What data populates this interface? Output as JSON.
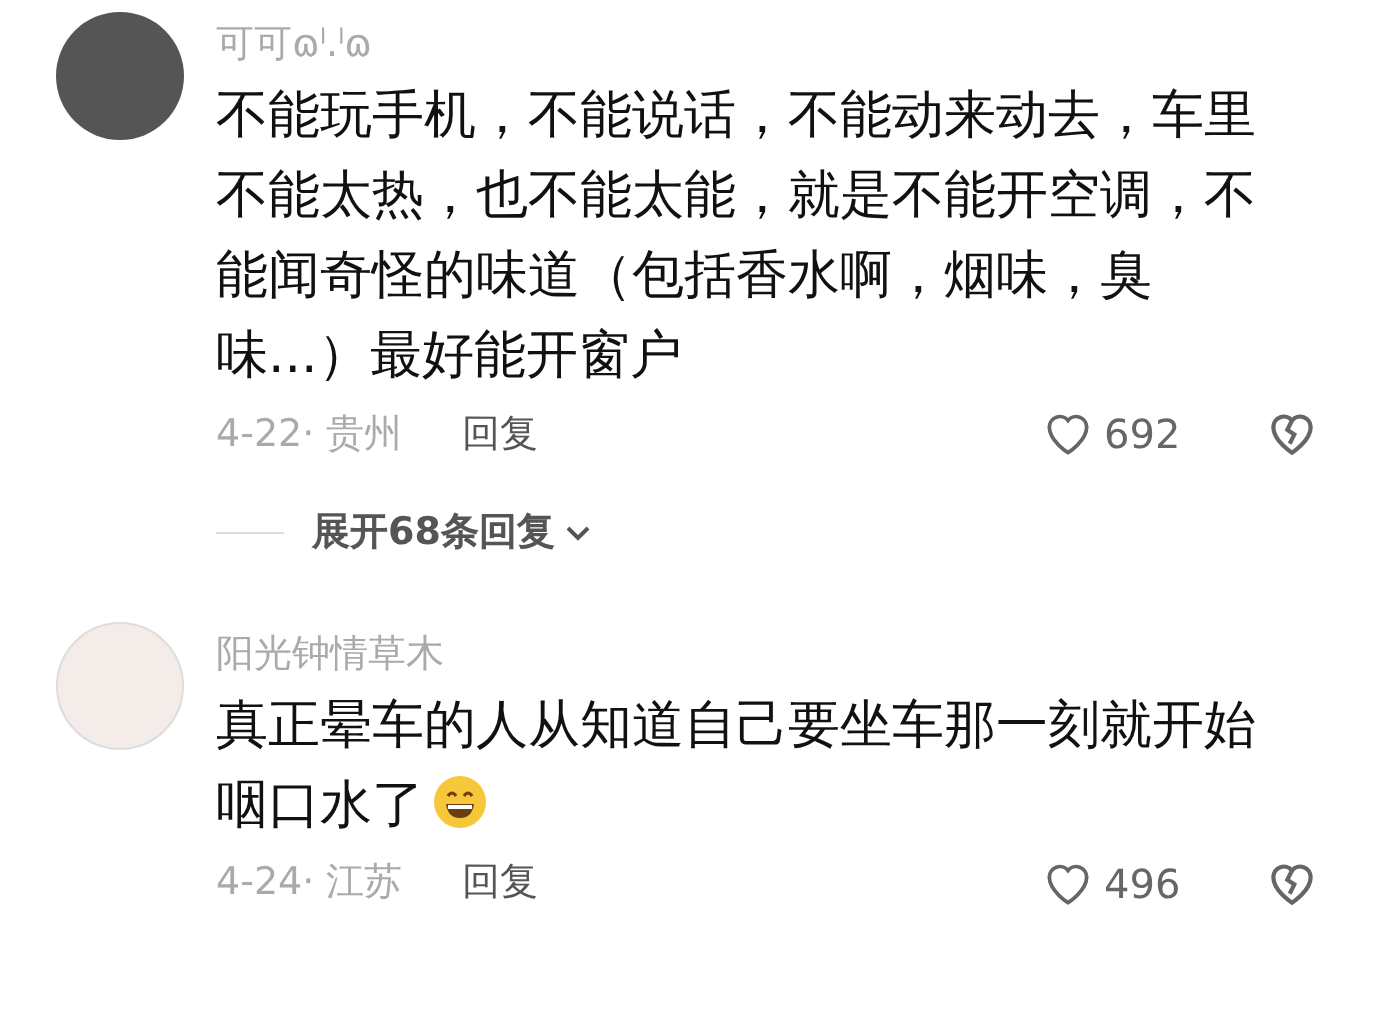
{
  "comments": [
    {
      "username": "可可ɷˡ.ˡɷ",
      "text": "不能玩手机，不能说话，不能动来动去，车里不能太热，也不能太能，就是不能开空调，不能闻奇怪的味道（包括香水啊，烟味，臭味...）最好能开窗户",
      "emoji": false,
      "meta": "4-22· 贵州",
      "reply": "回复",
      "likes": "692",
      "expand": "展开68条回复"
    },
    {
      "username": "阳光钟情草木",
      "text": "真正晕车的人从知道自己要坐车那一刻就开始咽口水了",
      "emoji": true,
      "meta": "4-24· 江苏",
      "reply": "回复",
      "likes": "496"
    }
  ]
}
